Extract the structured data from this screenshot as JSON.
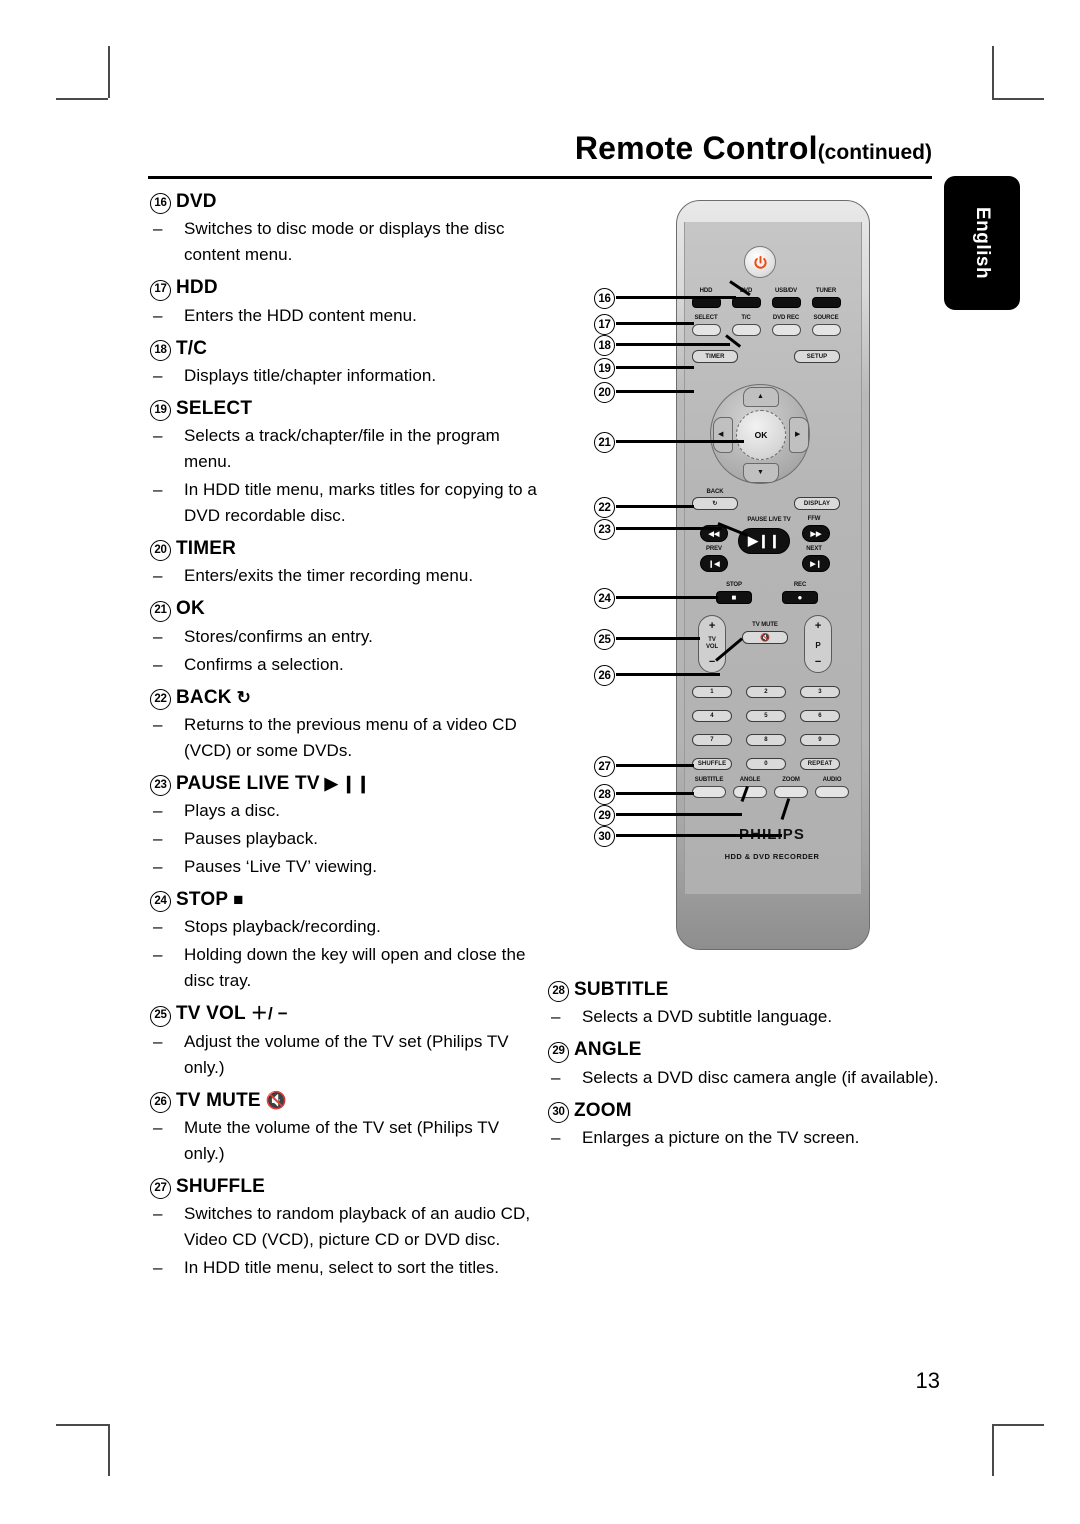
{
  "header": {
    "title": "Remote Control",
    "continued": "(continued)",
    "side_tab": "English"
  },
  "page_number": "13",
  "entries_left": [
    {
      "num": "16",
      "label": "DVD",
      "glyph": "",
      "bullets": [
        "Switches to disc mode or displays the disc content menu."
      ]
    },
    {
      "num": "17",
      "label": "HDD",
      "glyph": "",
      "bullets": [
        "Enters the HDD content menu."
      ]
    },
    {
      "num": "18",
      "label": "T/C",
      "glyph": "",
      "bullets": [
        "Displays title/chapter information."
      ]
    },
    {
      "num": "19",
      "label": "SELECT",
      "glyph": "",
      "bullets": [
        "Selects a track/chapter/file in the program menu.",
        "In HDD title menu, marks titles for copying to a DVD recordable disc."
      ]
    },
    {
      "num": "20",
      "label": "TIMER",
      "glyph": "",
      "bullets": [
        "Enters/exits the timer recording menu."
      ]
    },
    {
      "num": "21",
      "label": "OK",
      "glyph": "",
      "bullets": [
        "Stores/confirms an entry.",
        "Confirms a selection."
      ]
    },
    {
      "num": "22",
      "label": "BACK",
      "glyph": "↻",
      "bullets": [
        "Returns to the previous menu of a video CD (VCD) or some DVDs."
      ]
    },
    {
      "num": "23",
      "label": "PAUSE LIVE TV",
      "glyph": "▶ ❙❙",
      "bullets": [
        "Plays a disc.",
        "Pauses playback.",
        "Pauses ‘Live TV’ viewing."
      ]
    },
    {
      "num": "24",
      "label": "STOP",
      "glyph": "■",
      "bullets": [
        "Stops playback/recording.",
        "Holding down the key will open and close the disc tray."
      ]
    },
    {
      "num": "25",
      "label": "TV VOL",
      "glyph": "＋/ −",
      "bullets": [
        "Adjust the volume of the TV set (Philips TV only.)"
      ]
    },
    {
      "num": "26",
      "label": "TV MUTE",
      "glyph": "🔇",
      "bullets": [
        "Mute the volume of the TV set (Philips TV only.)"
      ]
    },
    {
      "num": "27",
      "label": "SHUFFLE",
      "glyph": "",
      "bullets": [
        "Switches to random playback of an audio CD, Video CD (VCD), picture CD or DVD disc.",
        "In HDD title menu, select to sort the titles."
      ]
    }
  ],
  "entries_right": [
    {
      "num": "28",
      "label": "SUBTITLE",
      "glyph": "",
      "bullets": [
        "Selects a DVD subtitle language."
      ]
    },
    {
      "num": "29",
      "label": "ANGLE",
      "glyph": "",
      "bullets": [
        "Selects a DVD disc camera angle (if available)."
      ]
    },
    {
      "num": "30",
      "label": "ZOOM",
      "glyph": "",
      "bullets": [
        "Enlarges a picture on the TV screen."
      ]
    }
  ],
  "remote": {
    "brand": "PHILIPS",
    "model_label": "HDD & DVD RECORDER",
    "power_icon": "power-icon",
    "ok_label": "OK",
    "buttons": {
      "hdd": "HDD",
      "dvd": "DVD",
      "usb_dv": "USB/DV",
      "tuner": "TUNER",
      "select": "SELECT",
      "tc": "T/C",
      "dvd_rec": "DVD REC",
      "source": "SOURCE",
      "timer": "TIMER",
      "setup": "SETUP",
      "back": "BACK",
      "display": "DISPLAY",
      "pause_live_tv": "PAUSE LIVE TV",
      "ffw": "FFW",
      "prev": "PREV",
      "next": "NEXT",
      "stop": "STOP",
      "rec": "REC",
      "tv_vol": "TV VOL",
      "tv_mute": "TV MUTE",
      "p": "P",
      "plus": "+",
      "minus": "−",
      "shuffle": "SHUFFLE",
      "repeat": "REPEAT",
      "subtitle": "SUBTITLE",
      "angle": "ANGLE",
      "zoom": "ZOOM",
      "audio": "AUDIO"
    },
    "numeric_keys": [
      "1",
      "2",
      "3",
      "4",
      "5",
      "6",
      "7",
      "8",
      "9",
      "0"
    ],
    "callouts": [
      "16",
      "17",
      "18",
      "19",
      "20",
      "21",
      "22",
      "23",
      "24",
      "25",
      "26",
      "27",
      "28",
      "29",
      "30"
    ]
  }
}
